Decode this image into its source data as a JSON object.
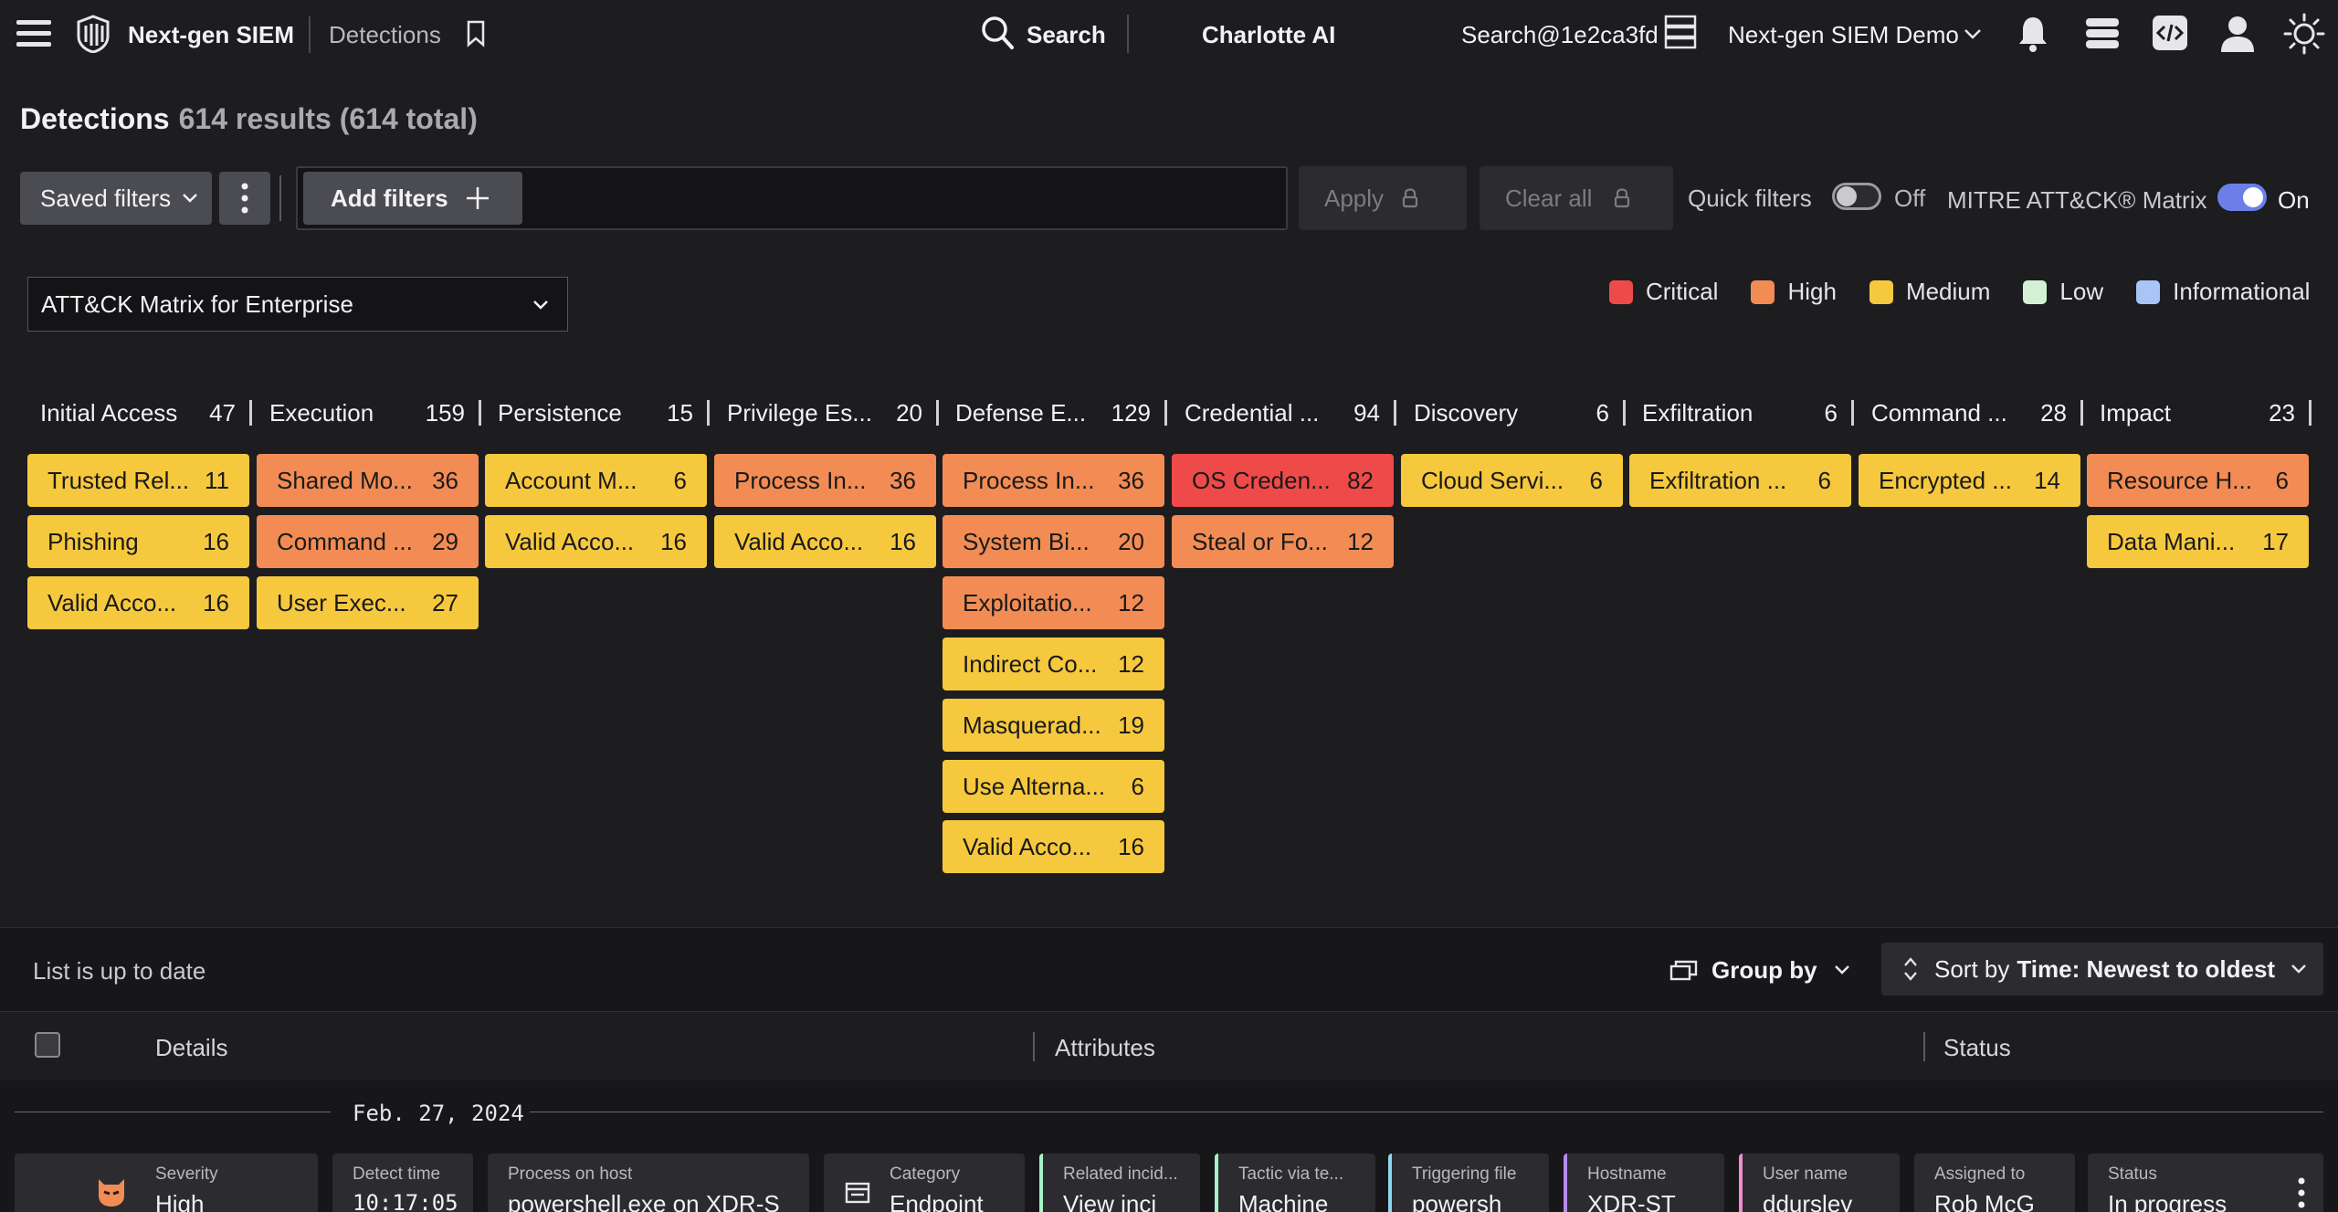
{
  "topbar": {
    "app_name": "Next-gen SIEM",
    "breadcrumb": "Detections",
    "search_label": "Search",
    "charlotte": "Charlotte AI",
    "search_id": "Search@1e2ca3fd",
    "tenant": "Next-gen SIEM Demo"
  },
  "header": {
    "title": "Detections",
    "count": "614 results (614 total)"
  },
  "filters": {
    "saved_filters": "Saved filters",
    "add_filters": "Add filters",
    "apply": "Apply",
    "clear_all": "Clear all",
    "quick_filters": "Quick filters",
    "quick_filters_state": "Off",
    "mitre_label": "MITRE ATT&CK® Matrix",
    "mitre_state": "On"
  },
  "matrix": {
    "selector": "ATT&CK Matrix for Enterprise",
    "legend": [
      {
        "label": "Critical",
        "color": "#ef4a4a"
      },
      {
        "label": "High",
        "color": "#f28c54"
      },
      {
        "label": "Medium",
        "color": "#f6c83e"
      },
      {
        "label": "Low",
        "color": "#d3f0d4"
      },
      {
        "label": "Informational",
        "color": "#a9c4f7"
      }
    ],
    "columns": [
      {
        "name": "Initial Access",
        "count": "47",
        "techniques": [
          {
            "name": "Trusted Rel...",
            "count": "11",
            "severity": "medium"
          },
          {
            "name": "Phishing",
            "count": "16",
            "severity": "medium"
          },
          {
            "name": "Valid Acco...",
            "count": "16",
            "severity": "medium"
          }
        ]
      },
      {
        "name": "Execution",
        "count": "159",
        "techniques": [
          {
            "name": "Shared Mo...",
            "count": "36",
            "severity": "high"
          },
          {
            "name": "Command ...",
            "count": "29",
            "severity": "high"
          },
          {
            "name": "User Exec...",
            "count": "27",
            "severity": "medium"
          }
        ]
      },
      {
        "name": "Persistence",
        "count": "15",
        "techniques": [
          {
            "name": "Account M...",
            "count": "6",
            "severity": "medium"
          },
          {
            "name": "Valid Acco...",
            "count": "16",
            "severity": "medium"
          }
        ]
      },
      {
        "name": "Privilege Es...",
        "count": "20",
        "techniques": [
          {
            "name": "Process In...",
            "count": "36",
            "severity": "high"
          },
          {
            "name": "Valid Acco...",
            "count": "16",
            "severity": "medium"
          }
        ]
      },
      {
        "name": "Defense E...",
        "count": "129",
        "techniques": [
          {
            "name": "Process In...",
            "count": "36",
            "severity": "high"
          },
          {
            "name": "System Bi...",
            "count": "20",
            "severity": "high"
          },
          {
            "name": "Exploitatio...",
            "count": "12",
            "severity": "high"
          },
          {
            "name": "Indirect Co...",
            "count": "12",
            "severity": "medium"
          },
          {
            "name": "Masquerad...",
            "count": "19",
            "severity": "medium"
          },
          {
            "name": "Use Alterna...",
            "count": "6",
            "severity": "medium"
          },
          {
            "name": "Valid Acco...",
            "count": "16",
            "severity": "medium"
          }
        ]
      },
      {
        "name": "Credential ...",
        "count": "94",
        "techniques": [
          {
            "name": "OS Creden...",
            "count": "82",
            "severity": "critical"
          },
          {
            "name": "Steal or Fo...",
            "count": "12",
            "severity": "high"
          }
        ]
      },
      {
        "name": "Discovery",
        "count": "6",
        "techniques": [
          {
            "name": "Cloud Servi...",
            "count": "6",
            "severity": "medium"
          }
        ]
      },
      {
        "name": "Exfiltration",
        "count": "6",
        "techniques": [
          {
            "name": "Exfiltration ...",
            "count": "6",
            "severity": "medium"
          }
        ]
      },
      {
        "name": "Command ...",
        "count": "28",
        "techniques": [
          {
            "name": "Encrypted ...",
            "count": "14",
            "severity": "medium"
          }
        ]
      },
      {
        "name": "Impact",
        "count": "23",
        "techniques": [
          {
            "name": "Resource H...",
            "count": "6",
            "severity": "high"
          },
          {
            "name": "Data Mani...",
            "count": "17",
            "severity": "medium"
          }
        ]
      }
    ]
  },
  "list": {
    "status": "List is up to date",
    "group_by": "Group by",
    "sort_prefix": "Sort by",
    "sort_value": "Time: Newest to oldest",
    "columns": [
      "Details",
      "Attributes",
      "Status"
    ],
    "date": "Feb. 27, 2024",
    "row": [
      {
        "label": "Severity",
        "value": "High"
      },
      {
        "label": "Detect time",
        "value": "10:17:05"
      },
      {
        "label": "Process on host",
        "value": "powershell.exe on XDR-S"
      },
      {
        "label": "Category",
        "value": "Endpoint"
      },
      {
        "label": "Related incid...",
        "value": "View inci"
      },
      {
        "label": "Tactic via te...",
        "value": "Machine"
      },
      {
        "label": "Triggering file",
        "value": "powersh"
      },
      {
        "label": "Hostname",
        "value": "XDR-ST"
      },
      {
        "label": "User name",
        "value": "ddursley"
      },
      {
        "label": "Assigned to",
        "value": "Rob McG"
      },
      {
        "label": "Status",
        "value": "In progress"
      }
    ]
  }
}
